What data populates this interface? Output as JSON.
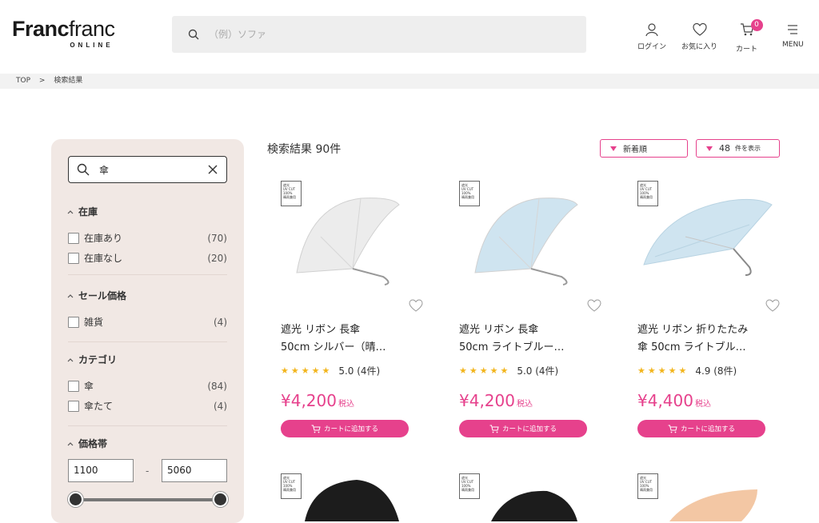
{
  "brand": {
    "logo_bold": "Franc",
    "logo_light": "franc",
    "logo_sub": "ONLINE"
  },
  "search": {
    "placeholder": "（例）ソファ"
  },
  "header_nav": {
    "login": "ログイン",
    "favorites": "お気に入り",
    "cart": "カート",
    "cart_count": "0",
    "menu": "MENU"
  },
  "breadcrumb": {
    "top": "TOP",
    "sep": ">",
    "current": "検索結果"
  },
  "sidebar": {
    "query": "傘",
    "facets": [
      {
        "title": "在庫",
        "options": [
          {
            "label": "在庫あり",
            "count": "(70)"
          },
          {
            "label": "在庫なし",
            "count": "(20)"
          }
        ]
      },
      {
        "title": "セール価格",
        "options": [
          {
            "label": "雑貨",
            "count": "(4)"
          }
        ]
      },
      {
        "title": "カテゴリ",
        "options": [
          {
            "label": "傘",
            "count": "(84)"
          },
          {
            "label": "傘たて",
            "count": "(4)"
          }
        ]
      },
      {
        "title": "価格帯",
        "min": "1100",
        "max": "5060",
        "dash": "-"
      }
    ]
  },
  "results": {
    "title": "検索結果 90件",
    "sort": "新着順",
    "per_page_value": "48",
    "per_page_suffix": "件を表示"
  },
  "tag": {
    "l1": "晴雨兼用",
    "l2": "UV CUT",
    "l3": "100%",
    "l4": "遮光"
  },
  "products": [
    {
      "name_line1": "遮光 リボン 長傘",
      "name_line2": "50cm シルバー（晴…",
      "stars": "★★★★★",
      "rating": "5.0 (4件)",
      "price": "¥4,200",
      "tax": "税込",
      "cart": "カートに追加する",
      "color": "#ececec"
    },
    {
      "name_line1": "遮光 リボン 長傘",
      "name_line2": "50cm ライトブルー…",
      "stars": "★★★★★",
      "rating": "5.0 (4件)",
      "price": "¥4,200",
      "tax": "税込",
      "cart": "カートに追加する",
      "color": "#cfe4f0"
    },
    {
      "name_line1": "遮光 リボン 折りたたみ",
      "name_line2": "傘 50cm ライトブル…",
      "stars": "★★★★★",
      "rating": "4.9 (8件)",
      "price": "¥4,400",
      "tax": "税込",
      "cart": "カートに追加する",
      "color": "#cfe4f0"
    }
  ],
  "colors": {
    "accent": "#e6418c",
    "sidebar_bg": "#f1e8e4",
    "star": "#f2b51d"
  }
}
